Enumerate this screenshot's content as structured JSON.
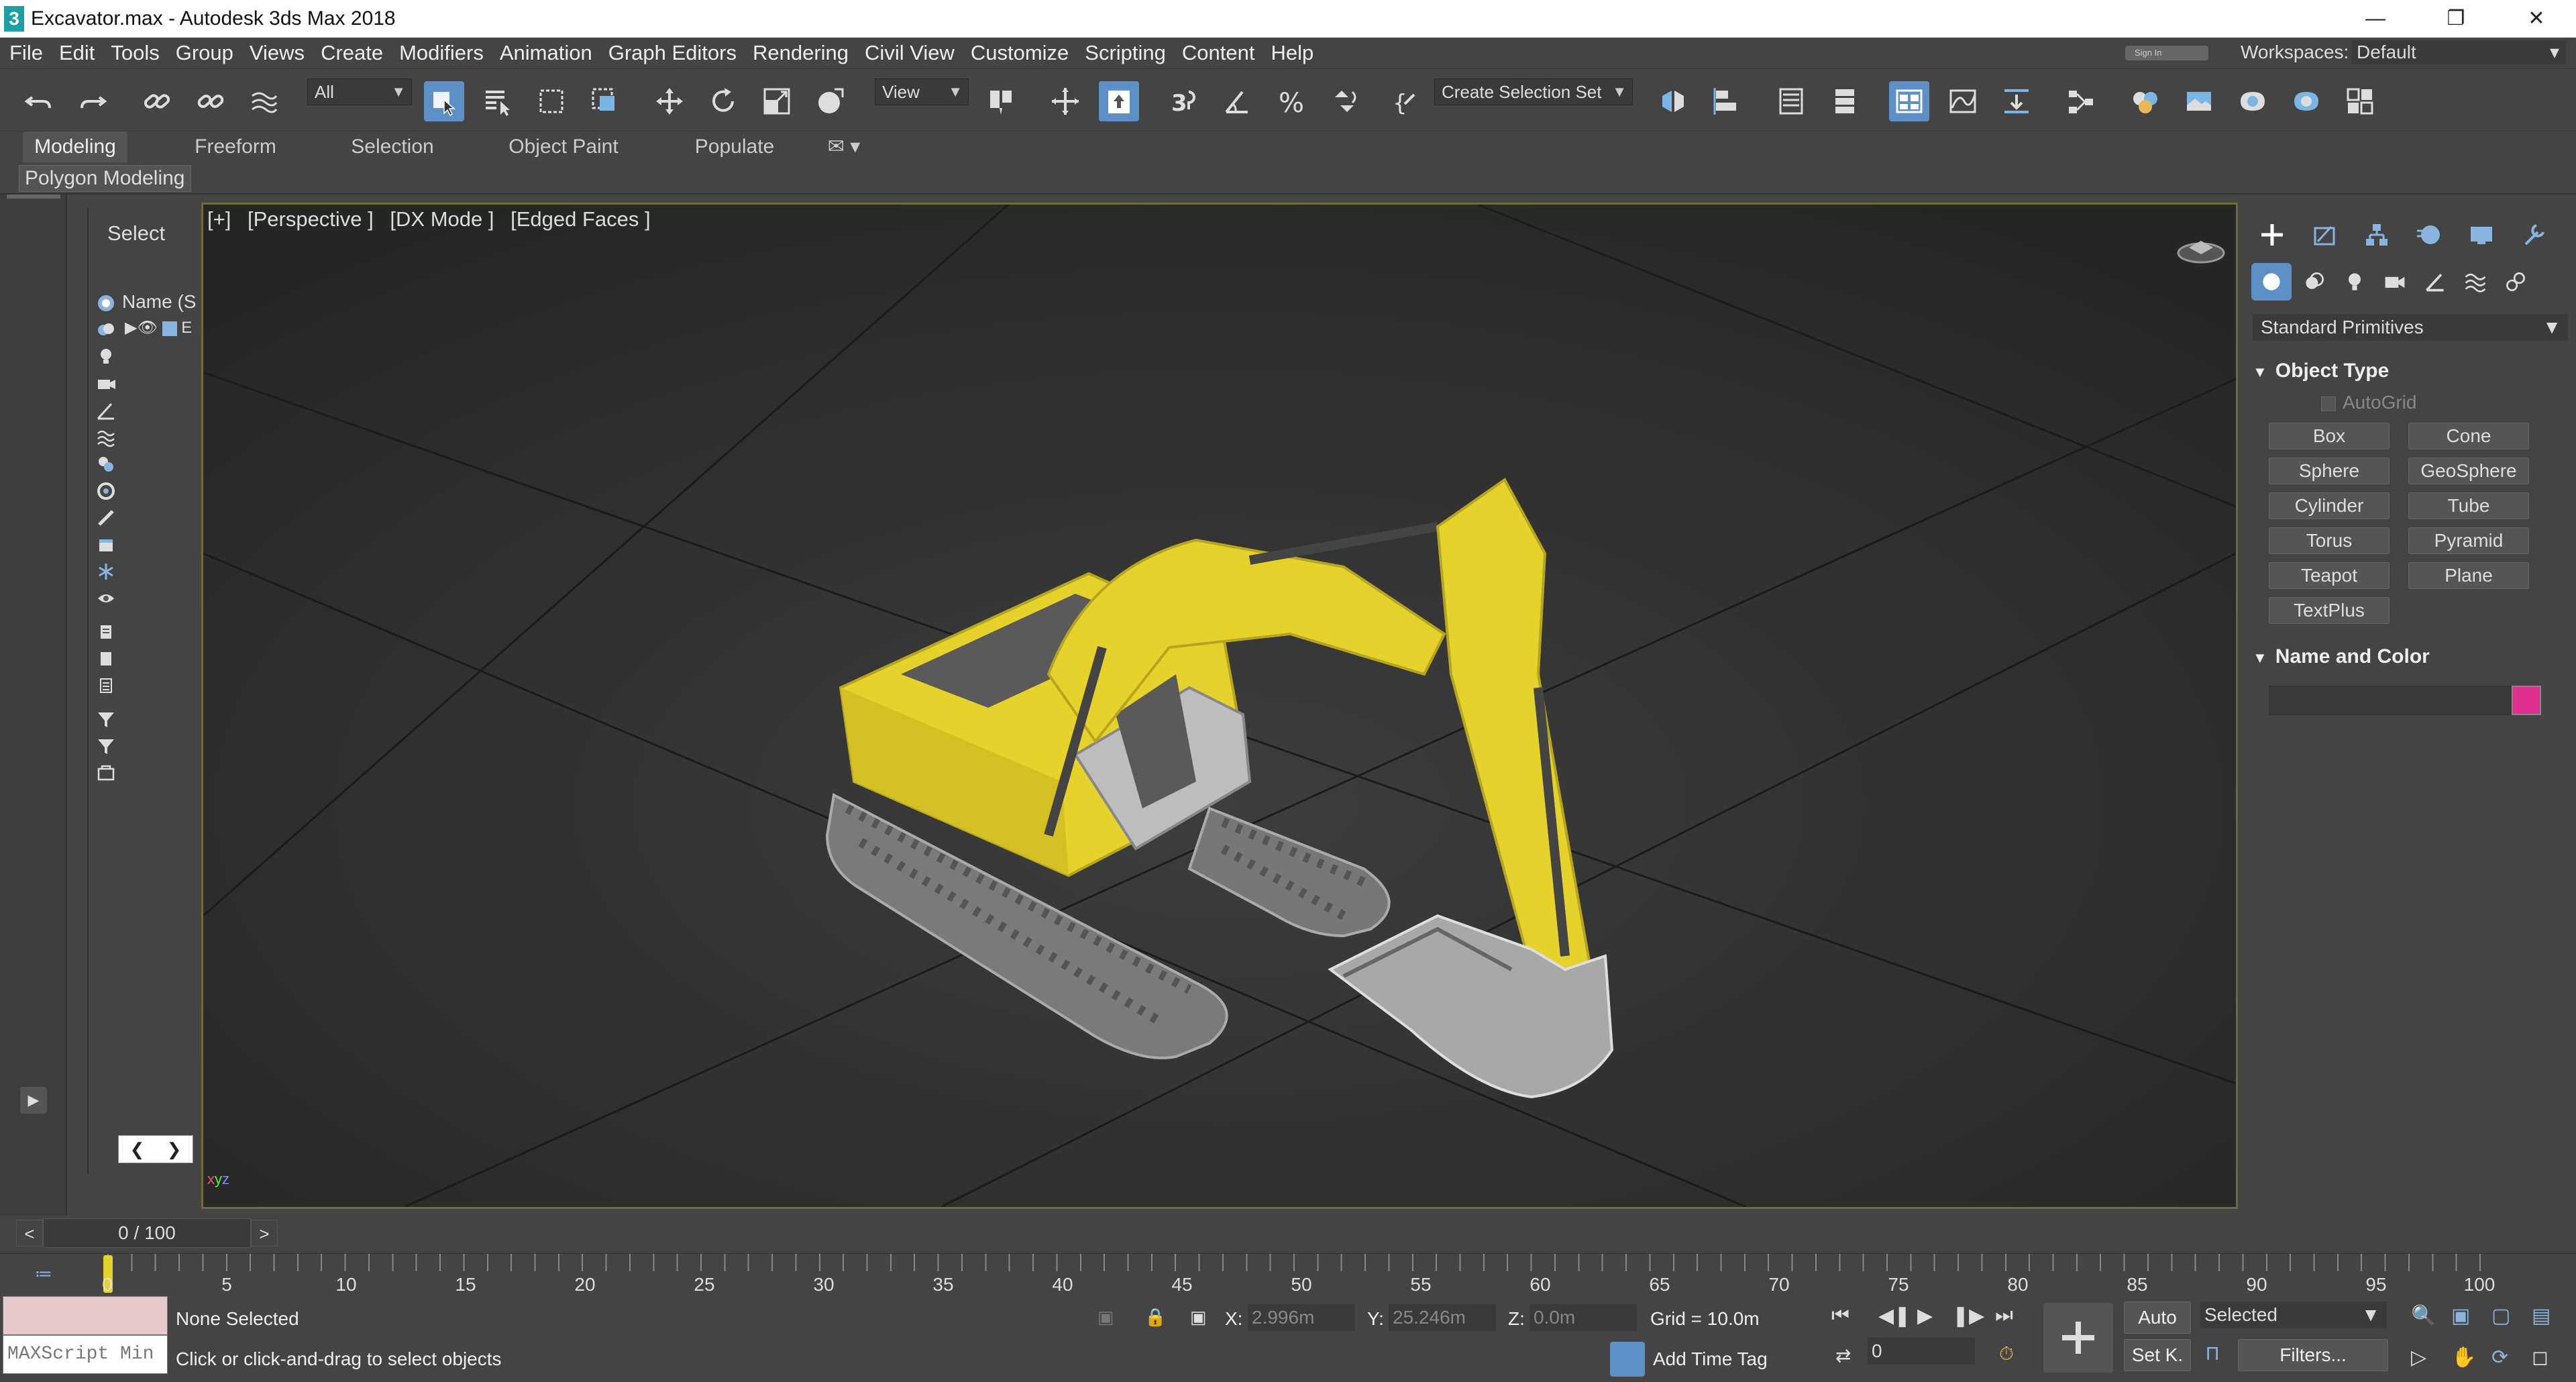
{
  "window": {
    "title": "Excavator.max - Autodesk 3ds Max 2018",
    "app_icon": "3"
  },
  "menubar": {
    "items": [
      "File",
      "Edit",
      "Tools",
      "Group",
      "Views",
      "Create",
      "Modifiers",
      "Animation",
      "Graph Editors",
      "Rendering",
      "Civil View",
      "Customize",
      "Scripting",
      "Content",
      "Help"
    ],
    "sign_in": "Sign In",
    "workspaces_label": "Workspaces:",
    "workspace_value": "Default"
  },
  "toolbar": {
    "selection_filter": "All",
    "reference_coord": "View",
    "named_selection": "Create Selection Set"
  },
  "ribbon": {
    "tabs": [
      "Modeling",
      "Freeform",
      "Selection",
      "Object Paint",
      "Populate"
    ],
    "active_tab": "Modeling",
    "sub_panel": "Polygon Modeling"
  },
  "scene_explorer": {
    "title": "Select",
    "column_header": "Name (S",
    "row_label": "E"
  },
  "viewport": {
    "label_plus": "[+]",
    "label_view": "[Perspective ]",
    "label_mode": "[DX Mode ]",
    "label_shading": "[Edged Faces ]"
  },
  "command_panel": {
    "category": "Standard Primitives",
    "object_type_title": "Object Type",
    "autogrid": "AutoGrid",
    "primitives": [
      "Box",
      "Cone",
      "Sphere",
      "GeoSphere",
      "Cylinder",
      "Tube",
      "Torus",
      "Pyramid",
      "Teapot",
      "Plane",
      "TextPlus"
    ],
    "name_color_title": "Name and Color",
    "swatch_color": "#e0308f"
  },
  "timeline": {
    "frame_display": "0 / 100",
    "prev": "<",
    "next": ">",
    "ticks": [
      "0",
      "5",
      "10",
      "15",
      "20",
      "25",
      "30",
      "35",
      "40",
      "45",
      "50",
      "55",
      "60",
      "65",
      "70",
      "75",
      "80",
      "85",
      "90",
      "95",
      "100"
    ]
  },
  "status": {
    "maxscript": "MAXScript Min",
    "selection": "None Selected",
    "prompt": "Click or click-and-drag to select objects",
    "x_label": "X:",
    "x_value": "2.996m",
    "y_label": "Y:",
    "y_value": "25.246m",
    "z_label": "Z:",
    "z_value": "0.0m",
    "grid": "Grid = 10.0m",
    "add_time_tag": "Add Time Tag",
    "auto": "Auto",
    "selected": "Selected",
    "set_key": "Set K.",
    "filters": "Filters...",
    "frame_field": "0"
  },
  "colors": {
    "accent": "#5e90c8",
    "excavator_yellow": "#e6d22a",
    "viewport_bg": "#2d2d2d"
  }
}
